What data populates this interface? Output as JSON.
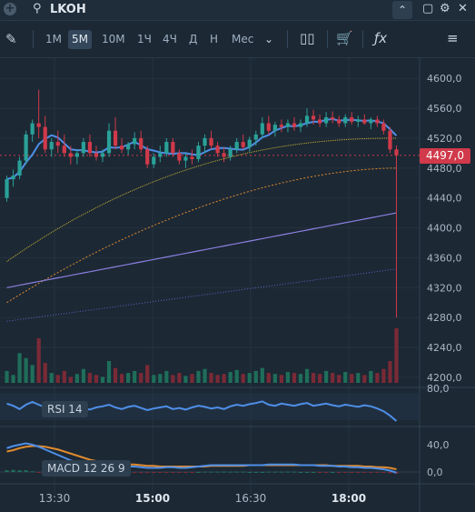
{
  "header": {
    "ticker": "LKOH"
  },
  "toolbar": {
    "timeframes": [
      "1M",
      "5M",
      "10M",
      "1Ч",
      "4Ч",
      "Д",
      "Н"
    ],
    "active_timeframe": "5M",
    "more_label": "Мес"
  },
  "price_axis": {
    "labels": [
      "4600,0",
      "4560,0",
      "4520,0",
      "4480,0",
      "4440,0",
      "4400,0",
      "4360,0",
      "4320,0",
      "4280,0",
      "4240,0",
      "4200,0"
    ],
    "current_price": "4497,0"
  },
  "rsi": {
    "label": "RSI 14",
    "axis_label": "80,0"
  },
  "macd": {
    "label": "MACD 12 26 9",
    "axis_labels": [
      "40,0",
      "0,0"
    ]
  },
  "time_axis": {
    "labels": [
      "13:30",
      "15:00",
      "16:30",
      "18:00"
    ]
  },
  "colors": {
    "up": "#2aa198",
    "down": "#d03a4a",
    "accent_line": "#4e8fe8",
    "background": "#1c2834"
  },
  "chart_data": {
    "type": "candlestick",
    "ylim": [
      4195,
      4610
    ],
    "candles": [
      [
        4440,
        4470,
        4435,
        4465
      ],
      [
        4465,
        4478,
        4455,
        4470
      ],
      [
        4470,
        4495,
        4465,
        4490
      ],
      [
        4490,
        4530,
        4485,
        4525
      ],
      [
        4525,
        4545,
        4515,
        4540
      ],
      [
        4540,
        4585,
        4520,
        4535
      ],
      [
        4535,
        4550,
        4500,
        4505
      ],
      [
        4505,
        4520,
        4495,
        4515
      ],
      [
        4515,
        4530,
        4500,
        4510
      ],
      [
        4510,
        4525,
        4495,
        4500
      ],
      [
        4500,
        4510,
        4485,
        4495
      ],
      [
        4495,
        4505,
        4485,
        4500
      ],
      [
        4500,
        4520,
        4495,
        4515
      ],
      [
        4515,
        4525,
        4495,
        4500
      ],
      [
        4500,
        4510,
        4490,
        4495
      ],
      [
        4495,
        4505,
        4488,
        4500
      ],
      [
        4500,
        4540,
        4495,
        4530
      ],
      [
        4530,
        4548,
        4505,
        4510
      ],
      [
        4510,
        4520,
        4500,
        4505
      ],
      [
        4505,
        4515,
        4498,
        4512
      ],
      [
        4512,
        4528,
        4505,
        4520
      ],
      [
        4520,
        4530,
        4500,
        4505
      ],
      [
        4505,
        4510,
        4480,
        4485
      ],
      [
        4485,
        4500,
        4480,
        4495
      ],
      [
        4495,
        4510,
        4488,
        4500
      ],
      [
        4500,
        4520,
        4495,
        4515
      ],
      [
        4515,
        4520,
        4495,
        4500
      ],
      [
        4500,
        4505,
        4485,
        4490
      ],
      [
        4490,
        4500,
        4480,
        4495
      ],
      [
        4495,
        4505,
        4485,
        4492
      ],
      [
        4492,
        4515,
        4488,
        4510
      ],
      [
        4510,
        4525,
        4500,
        4520
      ],
      [
        4520,
        4530,
        4505,
        4510
      ],
      [
        4510,
        4515,
        4495,
        4500
      ],
      [
        4500,
        4508,
        4488,
        4495
      ],
      [
        4495,
        4510,
        4490,
        4505
      ],
      [
        4505,
        4520,
        4500,
        4515
      ],
      [
        4515,
        4525,
        4505,
        4508
      ],
      [
        4508,
        4522,
        4502,
        4518
      ],
      [
        4518,
        4530,
        4510,
        4525
      ],
      [
        4525,
        4548,
        4520,
        4540
      ],
      [
        4540,
        4550,
        4525,
        4530
      ],
      [
        4530,
        4542,
        4522,
        4538
      ],
      [
        4538,
        4545,
        4528,
        4535
      ],
      [
        4535,
        4545,
        4528,
        4540
      ],
      [
        4540,
        4548,
        4530,
        4535
      ],
      [
        4535,
        4545,
        4528,
        4540
      ],
      [
        4540,
        4560,
        4535,
        4550
      ],
      [
        4550,
        4558,
        4538,
        4545
      ],
      [
        4545,
        4552,
        4535,
        4540
      ],
      [
        4540,
        4555,
        4535,
        4548
      ],
      [
        4548,
        4556,
        4540,
        4545
      ],
      [
        4545,
        4550,
        4535,
        4540
      ],
      [
        4540,
        4552,
        4535,
        4548
      ],
      [
        4548,
        4555,
        4538,
        4542
      ],
      [
        4542,
        4550,
        4535,
        4545
      ],
      [
        4545,
        4552,
        4538,
        4540
      ],
      [
        4540,
        4548,
        4532,
        4545
      ],
      [
        4545,
        4550,
        4535,
        4540
      ],
      [
        4540,
        4545,
        4525,
        4530
      ],
      [
        4530,
        4535,
        4500,
        4505
      ],
      [
        4505,
        4510,
        4280,
        4497
      ]
    ],
    "volumes": [
      12,
      8,
      30,
      25,
      18,
      45,
      20,
      10,
      8,
      12,
      6,
      9,
      14,
      10,
      8,
      6,
      22,
      15,
      9,
      10,
      12,
      10,
      18,
      8,
      9,
      12,
      8,
      10,
      7,
      9,
      12,
      14,
      10,
      8,
      9,
      11,
      13,
      9,
      10,
      12,
      15,
      10,
      9,
      8,
      11,
      10,
      9,
      14,
      10,
      9,
      12,
      10,
      8,
      11,
      9,
      10,
      8,
      12,
      10,
      14,
      22,
      55
    ],
    "rsi": [
      62,
      58,
      52,
      60,
      65,
      60,
      55,
      57,
      52,
      50,
      54,
      56,
      53,
      51,
      55,
      57,
      60,
      55,
      52,
      56,
      58,
      54,
      50,
      53,
      55,
      57,
      52,
      54,
      51,
      55,
      58,
      56,
      53,
      55,
      52,
      57,
      60,
      58,
      61,
      63,
      66,
      60,
      58,
      62,
      60,
      58,
      61,
      63,
      58,
      60,
      62,
      59,
      57,
      60,
      58,
      56,
      59,
      57,
      53,
      48,
      40,
      30
    ],
    "macd": [
      35,
      38,
      40,
      42,
      40,
      37,
      33,
      29,
      25,
      21,
      17,
      14,
      11,
      9,
      8,
      7,
      9,
      10,
      9,
      8,
      8,
      7,
      6,
      6,
      6,
      7,
      7,
      6,
      6,
      7,
      8,
      9,
      10,
      10,
      10,
      10,
      10,
      10,
      10,
      10,
      10,
      11,
      11,
      11,
      11,
      11,
      10,
      10,
      10,
      9,
      9,
      9,
      8,
      8,
      7,
      7,
      6,
      6,
      5,
      4,
      2,
      -1
    ],
    "signal": [
      30,
      32,
      35,
      37,
      38,
      38,
      37,
      35,
      33,
      30,
      27,
      24,
      21,
      18,
      16,
      14,
      13,
      12,
      12,
      11,
      11,
      10,
      9,
      9,
      8,
      8,
      8,
      8,
      8,
      8,
      8,
      8,
      9,
      9,
      9,
      9,
      9,
      9,
      10,
      10,
      10,
      10,
      10,
      10,
      10,
      10,
      10,
      10,
      10,
      10,
      10,
      9,
      9,
      9,
      9,
      9,
      8,
      8,
      7,
      7,
      6,
      4
    ]
  }
}
